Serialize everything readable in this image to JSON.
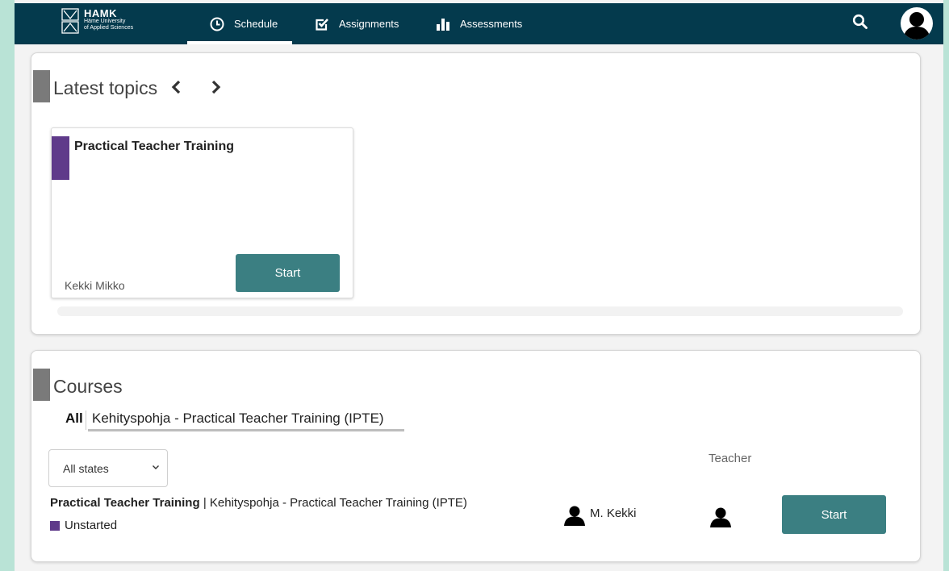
{
  "brand": {
    "name": "HAMK",
    "subtitle_line1": "Häme University",
    "subtitle_line2": "of Applied Sciences"
  },
  "nav": {
    "items": [
      {
        "label": "Schedule",
        "icon": "clock-icon",
        "active": true
      },
      {
        "label": "Assignments",
        "icon": "check-square-icon",
        "active": false
      },
      {
        "label": "Assessments",
        "icon": "bar-chart-icon",
        "active": false
      }
    ]
  },
  "latest_topics": {
    "title": "Latest topics",
    "topics": [
      {
        "title": "Practical Teacher Training",
        "author": "Kekki Mikko",
        "button": "Start",
        "color": "#5f3a8a"
      }
    ]
  },
  "courses": {
    "title": "Courses",
    "filter_all": "All",
    "filter_selected": "Kehityspohja - Practical Teacher Training (IPTE)",
    "state_select": "All states",
    "teacher_header": "Teacher",
    "rows": [
      {
        "name": "Practical Teacher Training",
        "separator": "|",
        "template": "Kehityspohja - Practical Teacher Training (IPTE)",
        "status": "Unstarted",
        "status_color": "#5f3a8a",
        "teacher": "M. Kekki",
        "button": "Start"
      }
    ]
  },
  "colors": {
    "topbar": "#043a4d",
    "accent_button": "#3b7f82",
    "outer_background": "#b9e3d6"
  }
}
